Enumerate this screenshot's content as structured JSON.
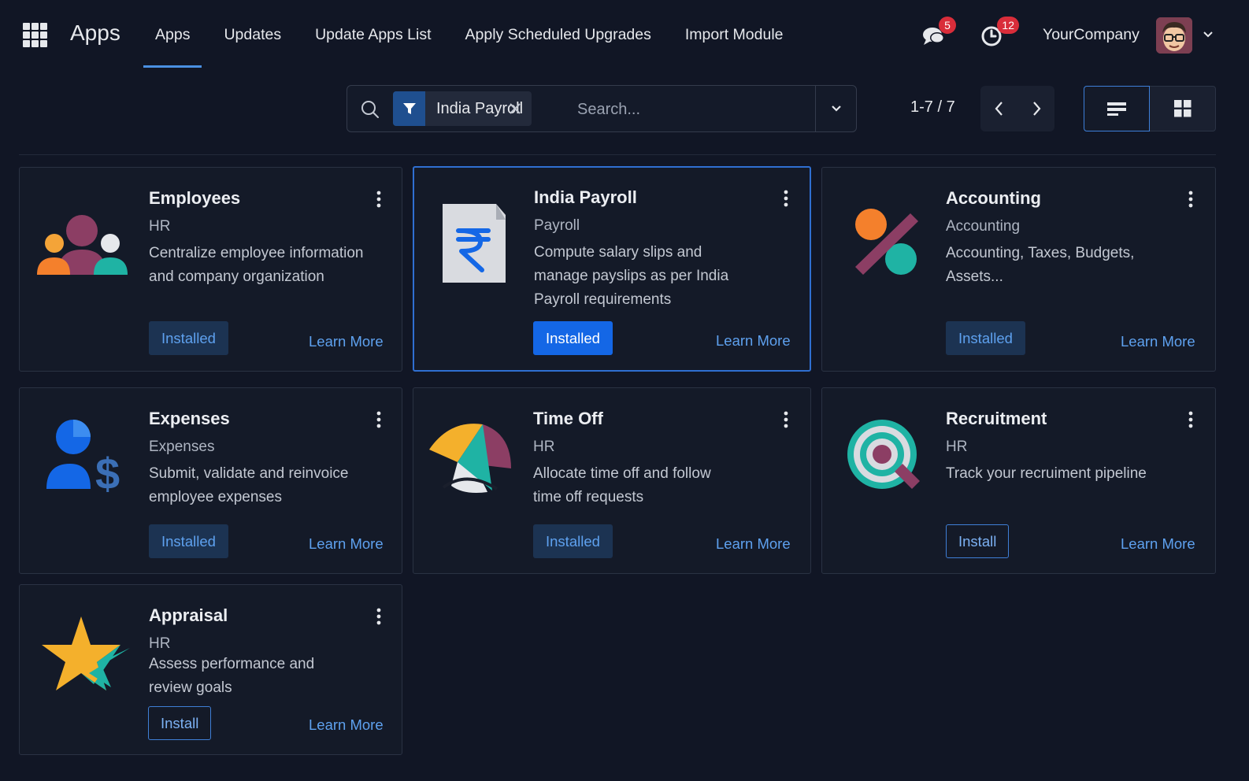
{
  "navbar": {
    "brand": "Apps",
    "menu": [
      {
        "label": "Apps",
        "active": true
      },
      {
        "label": "Updates"
      },
      {
        "label": "Update Apps List"
      },
      {
        "label": "Apply Scheduled Upgrades"
      },
      {
        "label": "Import Module"
      }
    ],
    "messages_badge": "5",
    "activities_badge": "12",
    "company": "YourCompany"
  },
  "control_panel": {
    "facet": {
      "label": "India Payroll",
      "icon": "filter-icon"
    },
    "search_placeholder": "Search...",
    "pager": "1-7 / 7",
    "views": [
      "list-view-icon",
      "kanban-view-icon"
    ]
  },
  "colors": {
    "background": "#111625",
    "card": "#141a28",
    "accent": "#1467e6",
    "link": "#5ea1ef",
    "badge": "#d92d3a"
  },
  "apps": [
    {
      "name": "Employees",
      "category": "HR",
      "description": "Centralize employee information and company organization",
      "button": "Installed",
      "learn": "Learn More",
      "icon": "employees-icon"
    },
    {
      "name": "India Payroll",
      "category": "Payroll",
      "description": "Compute salary slips and manage payslips as per India Payroll requirements",
      "button": "Installed",
      "learn": "Learn More",
      "icon": "rupee-document-icon"
    },
    {
      "name": "Accounting",
      "category": "Accounting",
      "description": "Accounting, Taxes, Budgets, Assets...",
      "button": "Installed",
      "learn": "Learn More",
      "icon": "accounting-icon"
    },
    {
      "name": "Expenses",
      "category": "Expenses",
      "description": "Submit, validate and reinvoice employee expenses",
      "button": "Installed",
      "learn": "Learn More",
      "icon": "expenses-icon"
    },
    {
      "name": "Time Off",
      "category": "HR",
      "description": "Allocate time off and follow time off requests",
      "button": "Installed",
      "learn": "Learn More",
      "icon": "umbrella-icon"
    },
    {
      "name": "Recruitment",
      "category": "HR",
      "description": "Track your recruiment pipeline",
      "button": "Install",
      "learn": "Learn More",
      "icon": "magnifier-icon"
    },
    {
      "name": "Appraisal",
      "category": "HR",
      "description": "Assess performance and review goals",
      "button": "Install",
      "learn": "Learn More",
      "icon": "star-icon"
    }
  ]
}
